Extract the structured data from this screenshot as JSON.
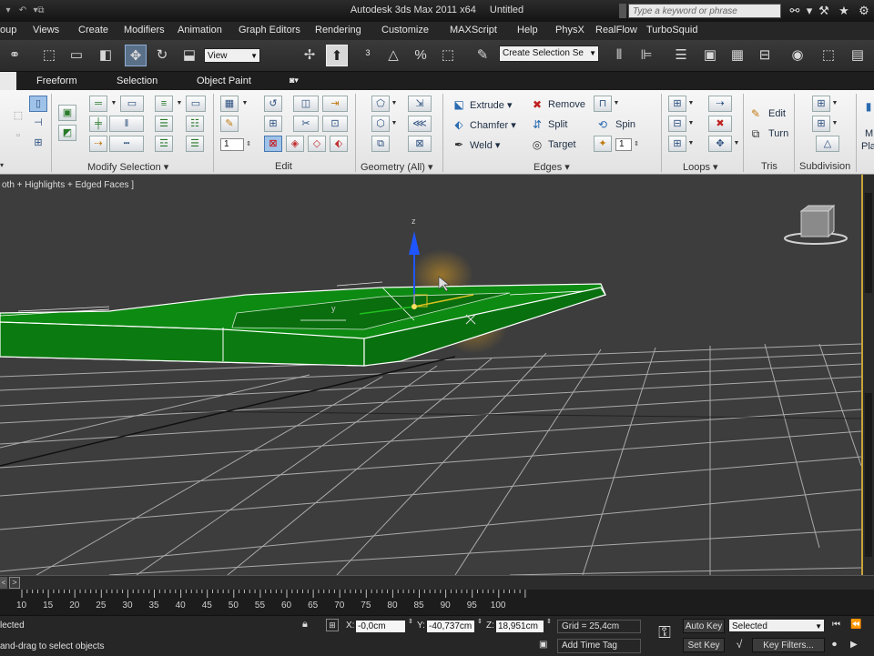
{
  "window": {
    "app_title": "Autodesk 3ds Max  2011 x64",
    "document": "Untitled",
    "search_placeholder": "Type a keyword or phrase"
  },
  "menu": [
    "oup",
    "Views",
    "Create",
    "Modifiers",
    "Animation",
    "Graph Editors",
    "Rendering",
    "Customize",
    "MAXScript",
    "Help",
    "PhysX",
    "RealFlow",
    "TurboSquid"
  ],
  "toolbar": {
    "ref_coord": "View",
    "named_selection": "Create Selection Se"
  },
  "ribbon_tabs": [
    "Freeform",
    "Selection",
    "Object Paint"
  ],
  "ribbon": {
    "panels": {
      "modify_selection": "Modify Selection",
      "edit": "Edit",
      "geometry": "Geometry (All)",
      "edges": "Edges",
      "loops": "Loops",
      "tris": "Tris",
      "subdivision": "Subdivision"
    },
    "edit_spinner": "1",
    "loops_spinner": "1",
    "edges": {
      "extrude": "Extrude",
      "chamfer": "Chamfer",
      "weld": "Weld",
      "remove": "Remove",
      "split": "Split",
      "target": "Target",
      "spin": "Spin"
    },
    "tris": {
      "edit": "Edit",
      "turn": "Turn"
    },
    "far_right": {
      "line1": "M",
      "line2": "Pla"
    }
  },
  "viewport": {
    "label": "oth + Highlights + Edged Faces ]",
    "gizmo_z": "z",
    "gizmo_y": "y"
  },
  "time_slider": {
    "arrow": ">",
    "ticks": [
      "10",
      "15",
      "20",
      "25",
      "30",
      "35",
      "40",
      "45",
      "50",
      "55",
      "60",
      "65",
      "70",
      "75",
      "80",
      "85",
      "90",
      "95",
      "100"
    ]
  },
  "status": {
    "selected_text": "lected",
    "prompt": "and-drag to select objects",
    "x_label": "X:",
    "x": "-0,0cm",
    "y_label": "Y:",
    "y": "-40,737cm",
    "z_label": "Z:",
    "z": "18,951cm",
    "grid": "Grid = 25,4cm",
    "add_time_tag": "Add Time Tag",
    "auto_key": "Auto Key",
    "selected_dropdown": "Selected",
    "set_key": "Set Key",
    "key_filters": "Key Filters..."
  },
  "colors": {
    "object_green": "#0d8a12",
    "selection_edge": "#ffffff",
    "viewport_bg": "#3d3d3d",
    "grid": "#c8c8c8",
    "gizmo_blue": "#1f55ff",
    "viewport_border": "#c8a23a"
  }
}
